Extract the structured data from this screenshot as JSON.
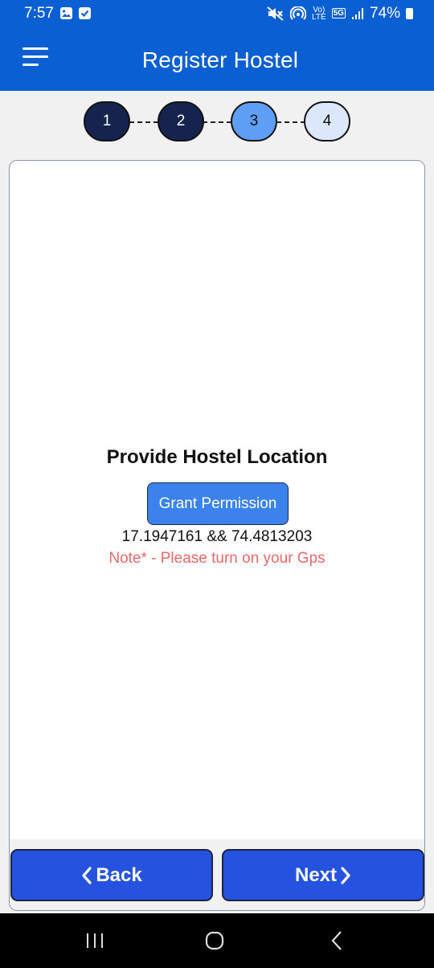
{
  "status_bar": {
    "time": "7:57",
    "battery": "74%",
    "volte": "Vo)",
    "lte": "LTE",
    "network": "5G",
    "icons": [
      "gallery-icon",
      "check-icon",
      "mute-icon",
      "hotspot-icon",
      "volte-icon",
      "5g-icon",
      "signal-icon",
      "battery-icon"
    ]
  },
  "app_bar": {
    "title": "Register Hostel",
    "menu_icon": "hamburger-menu-icon"
  },
  "stepper": {
    "steps": [
      "1",
      "2",
      "3",
      "4"
    ],
    "current_step": 3,
    "colors": {
      "done": "#14244f",
      "current": "#5e9ef4",
      "upcoming": "#dbe8fc"
    }
  },
  "content": {
    "title": "Provide Hostel Location",
    "grant_button": "Grant Permission",
    "coordinates": "17.1947161 && 74.4813203",
    "note": "Note* - Please turn on your Gps"
  },
  "navigation": {
    "back_label": "Back",
    "next_label": "Next"
  },
  "system_nav": {
    "icons": [
      "recent-apps-icon",
      "home-icon",
      "back-icon"
    ]
  },
  "colors": {
    "primary": "#0a5fd3",
    "button": "#2553e0",
    "grant_button": "#3b82ec",
    "note": "#e46a6a"
  }
}
